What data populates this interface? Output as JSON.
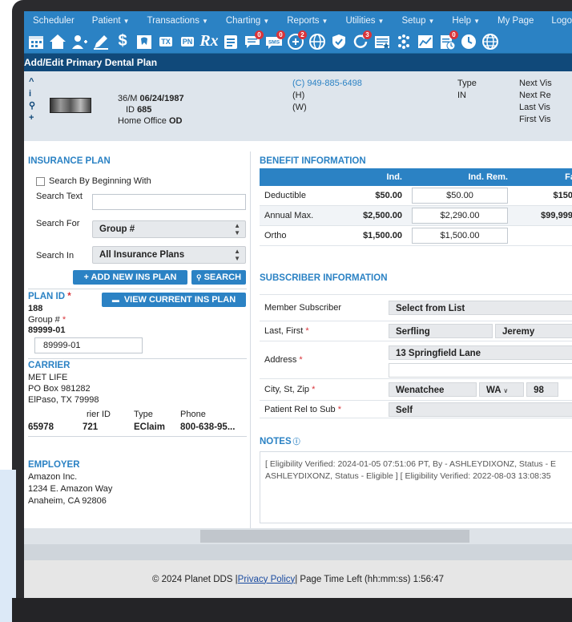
{
  "menu": [
    {
      "label": "Scheduler",
      "caret": false
    },
    {
      "label": "Patient",
      "caret": true
    },
    {
      "label": "Transactions",
      "caret": true
    },
    {
      "label": "Charting",
      "caret": true
    },
    {
      "label": "Reports",
      "caret": true
    },
    {
      "label": "Utilities",
      "caret": true
    },
    {
      "label": "Setup",
      "caret": true
    },
    {
      "label": "Help",
      "caret": true
    },
    {
      "label": "My Page",
      "caret": false
    },
    {
      "label": "Logo",
      "caret": false
    }
  ],
  "toolbar_icons": [
    {
      "name": "calendar-icon",
      "label": "",
      "badge": ""
    },
    {
      "name": "home-icon",
      "label": "",
      "badge": ""
    },
    {
      "name": "add-patient-icon",
      "label": "",
      "badge": ""
    },
    {
      "name": "edit-icon",
      "label": "",
      "badge": ""
    },
    {
      "name": "dollar-icon",
      "label": "$",
      "badge": ""
    },
    {
      "name": "tooth-chart-icon",
      "label": "",
      "badge": ""
    },
    {
      "name": "tx-plan-icon",
      "label": "TX",
      "badge": ""
    },
    {
      "name": "progress-notes-icon",
      "label": "PN",
      "badge": ""
    },
    {
      "name": "prescription-icon",
      "label": "Rx",
      "badge": ""
    },
    {
      "name": "forms-icon",
      "label": "",
      "badge": ""
    },
    {
      "name": "messages-icon",
      "label": "",
      "badge": "0"
    },
    {
      "name": "sms-icon",
      "label": "SMS",
      "badge": "0"
    },
    {
      "name": "referral-icon",
      "label": "",
      "badge": "2"
    },
    {
      "name": "globe-icon",
      "label": "",
      "badge": ""
    },
    {
      "name": "shield-icon",
      "label": "",
      "badge": ""
    },
    {
      "name": "refresh-icon",
      "label": "",
      "badge": "3"
    },
    {
      "name": "claims-icon",
      "label": "",
      "badge": ""
    },
    {
      "name": "tooth-icon",
      "label": "",
      "badge": ""
    },
    {
      "name": "graph-icon",
      "label": "",
      "badge": ""
    },
    {
      "name": "eligibility-icon",
      "label": "",
      "badge": "0"
    },
    {
      "name": "clock-icon",
      "label": "",
      "badge": ""
    },
    {
      "name": "world-icon",
      "label": "",
      "badge": ""
    }
  ],
  "page_title": "Add/Edit Primary Dental Plan",
  "patient": {
    "age_sex": "36/M",
    "dob": "06/24/1987",
    "id_label": "ID",
    "id": "685",
    "office_label": "Home Office",
    "office": "OD",
    "phone_cell": "(C) 949-885-6498",
    "phone_home": "(H)",
    "phone_work": "(W)",
    "type_label": "Type",
    "type": "IN",
    "visits": [
      "Next Vis",
      "Next Re",
      "Last Vis",
      "First Vis"
    ]
  },
  "insurance_plan": {
    "header": "INSURANCE PLAN",
    "search_beginning": "Search By Beginning With",
    "search_text_label": "Search Text",
    "search_for_label": "Search For",
    "search_for_value": "Group #",
    "search_in_label": "Search In",
    "search_in_value": "All Insurance Plans",
    "add_button": "+ ADD NEW INS PLAN",
    "search_button": "SEARCH"
  },
  "plan": {
    "plan_id_label": "PLAN ID",
    "plan_id": "188",
    "view_button": "VIEW CURRENT INS PLAN",
    "group_label": "Group #",
    "group_value": "89999-01",
    "group_input": "89999-01"
  },
  "carrier": {
    "header": "CARRIER",
    "name": "MET LIFE",
    "address1": "PO Box 981282",
    "address2": "ElPaso, TX 79998",
    "col_carrier_id": "rier ID",
    "col_type": "Type",
    "col_phone": "Phone",
    "payer": "65978",
    "carrier_id": "721",
    "type": "EClaim",
    "phone": "800-638-95..."
  },
  "employer": {
    "header": "EMPLOYER",
    "name": "Amazon Inc.",
    "address1": "1234 E. Amazon Way",
    "address2": "Anaheim, CA 92806"
  },
  "benefit": {
    "header": "BENEFIT INFORMATION",
    "col_ind": "Ind.",
    "col_ind_rem": "Ind. Rem.",
    "col_fam": "Fa",
    "rows": [
      {
        "label": "Deductible",
        "ind": "$50.00",
        "ind_rem": "$50.00",
        "fam": "$150."
      },
      {
        "label": "Annual Max.",
        "ind": "$2,500.00",
        "ind_rem": "$2,290.00",
        "fam": "$99,999."
      },
      {
        "label": "Ortho",
        "ind": "$1,500.00",
        "ind_rem": "$1,500.00",
        "fam": ""
      }
    ]
  },
  "subscriber": {
    "header": "SUBSCRIBER INFORMATION",
    "member_label": "Member Subscriber",
    "member_value": "Select from List",
    "name_label": "Last, First",
    "last": "Serfling",
    "first": "Jeremy",
    "address_label": "Address",
    "address1": "13 Springfield Lane",
    "address2": "",
    "city_label": "City, St, Zip",
    "city": "Wenatchee",
    "state": "WA",
    "zip": "98",
    "rel_label": "Patient Rel to Sub",
    "rel_value": "Self"
  },
  "notes": {
    "header": "NOTES",
    "line1": "[ Eligibility Verified: 2024-01-05 07:51:06 PT, By - ASHLEYDIXONZ, Status - E",
    "line2": "ASHLEYDIXONZ, Status - Eligible ] [ Eligibility Verified: 2022-08-03 13:08:35"
  },
  "footer": {
    "copyright": "© 2024 Planet DDS | ",
    "privacy": "Privacy Policy",
    "rest": " | Page Time Left (hh:mm:ss) 1:56:47"
  },
  "colors": {
    "primary": "#2b82c4",
    "title_bar": "#10497a",
    "required": "#d9343a"
  }
}
